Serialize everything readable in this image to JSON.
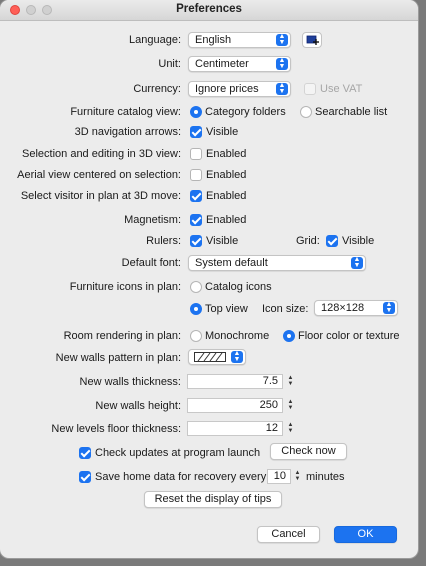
{
  "window": {
    "title": "Preferences"
  },
  "language": {
    "label": "Language:",
    "value": "English"
  },
  "unit": {
    "label": "Unit:",
    "value": "Centimeter"
  },
  "currency": {
    "label": "Currency:",
    "value": "Ignore prices",
    "vat_label": "Use VAT",
    "vat_checked": false
  },
  "catalog_view": {
    "label": "Furniture catalog view:",
    "opt1": "Category folders",
    "opt2": "Searchable list",
    "selected": "Category folders"
  },
  "nav_arrows": {
    "label": "3D navigation arrows:",
    "check_label": "Visible",
    "checked": true
  },
  "selection_3d": {
    "label": "Selection and editing in 3D view:",
    "check_label": "Enabled",
    "checked": false
  },
  "aerial": {
    "label": "Aerial view centered on selection:",
    "check_label": "Enabled",
    "checked": false
  },
  "visitor": {
    "label": "Select visitor in plan at 3D move:",
    "check_label": "Enabled",
    "checked": true
  },
  "magnetism": {
    "label": "Magnetism:",
    "check_label": "Enabled",
    "checked": true
  },
  "rulers": {
    "label": "Rulers:",
    "check_label": "Visible",
    "checked": true
  },
  "grid": {
    "label": "Grid:",
    "check_label": "Visible",
    "checked": true
  },
  "default_font": {
    "label": "Default font:",
    "value": "System default"
  },
  "furniture_icons": {
    "label": "Furniture icons in plan:",
    "opt1": "Catalog icons",
    "opt2": "Top view",
    "selected": "Top view",
    "icon_size_label": "Icon size:",
    "icon_size_value": "128×128"
  },
  "room_rendering": {
    "label": "Room rendering in plan:",
    "opt1": "Monochrome",
    "opt2": "Floor color or texture",
    "selected": "Floor color or texture"
  },
  "walls_pattern": {
    "label": "New walls pattern in plan:"
  },
  "walls_thickness": {
    "label": "New walls thickness:",
    "value": "7.5"
  },
  "walls_height": {
    "label": "New walls height:",
    "value": "250"
  },
  "floor_thickness": {
    "label": "New levels floor thickness:",
    "value": "12"
  },
  "updates": {
    "check_label": "Check updates at program launch",
    "checked": true,
    "button": "Check now"
  },
  "recovery": {
    "check_label": "Save home data for recovery every:",
    "checked": true,
    "value": "10",
    "unit": "minutes"
  },
  "reset_tips": {
    "button": "Reset the display of tips"
  },
  "footer": {
    "cancel": "Cancel",
    "ok": "OK"
  },
  "colors": {
    "accent": "#1c73f0",
    "close": "#ff5f57"
  }
}
